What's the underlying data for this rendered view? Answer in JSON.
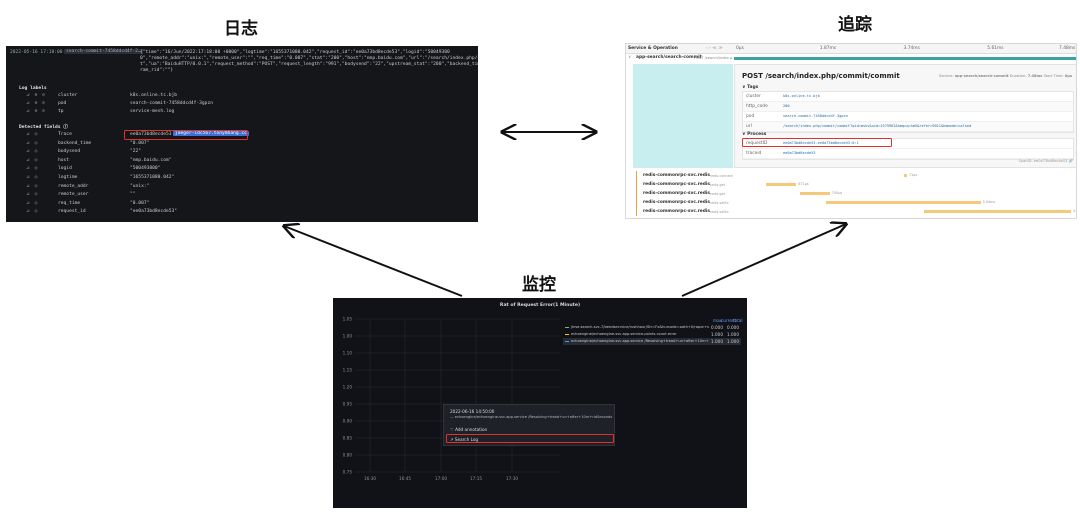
{
  "titles": {
    "log": "日志",
    "trace": "追踪",
    "monitor": "监控"
  },
  "log": {
    "timestamp": "2022-05-16 17:18:00",
    "pod_tag": "search-commit-7458ddcd4f-2…",
    "json_lines": [
      "{\"time\":\"16/Jun/2022:17:18:00 +0800\",\"logtime\":\"1655371080.042\",\"request_id\":\"ee0a73bd8ecde53\",\"logid\":\"50049380",
      "0\",\"remote_addr\":\"unix:\",\"remote_user\":\"\",\"req_time\":\"0.007\",\"stat\":\"200\",\"host\":\"nmp.baidu.com\",\"url\":\"/search/index.php/commit/commi",
      "t\",\"ua\":\"BaiduHTTP/0.0.1\",\"request_method\":\"POST\",\"request_length\":\"991\",\"bodysend\":\"22\",\"upstream_stat\":\"200\",\"backend_time\":\"0.007\",\"upstr",
      "ram_rid\":\"\"}"
    ],
    "labels_header": "Log labels",
    "labels": [
      {
        "key": "cluster",
        "value": "k8s.online.tc.bjb"
      },
      {
        "key": "pod",
        "value": "search-commit-7458ddcd4f-3gpzn"
      },
      {
        "key": "tp",
        "value": "service-mesh.log"
      }
    ],
    "fields_header": "Detected fields ⓘ",
    "fields": [
      {
        "key": "Trace",
        "value": "ee0a73bd8ecde53",
        "tag": "jaeger-idc567.tonymhang.cc"
      },
      {
        "key": "backend_time",
        "value": "\"0.007\""
      },
      {
        "key": "bodysend",
        "value": "\"22\""
      },
      {
        "key": "host",
        "value": "\"nmp.baidu.com\""
      },
      {
        "key": "logid",
        "value": "\"500493800\""
      },
      {
        "key": "logtime",
        "value": "\"1655371080.042\""
      },
      {
        "key": "remote_addr",
        "value": "\"unix:\""
      },
      {
        "key": "remote_user",
        "value": "\"\""
      },
      {
        "key": "req_time",
        "value": "\"0.007\""
      },
      {
        "key": "request_id",
        "value": "\"ee0a73bd8ecde53\""
      }
    ]
  },
  "trace": {
    "header": {
      "col1": "Service & Operation",
      "ticks": [
        "0μs",
        "1.87ms",
        "3.74ms",
        "5.61ms",
        "7.48ms"
      ]
    },
    "root_span": "app-search/search-commit",
    "root_op": "POST /search/index.p…",
    "detail_title": "POST /search/index.php/commit/commit",
    "detail_service_label": "Service:",
    "detail_service": "app-search/search-commit",
    "detail_duration_label": "Duration:",
    "detail_duration": "7.48ms",
    "detail_start_label": "Start Time:",
    "detail_start": "0μs",
    "tags_header": "Tags",
    "tags": [
      {
        "key": "cluster",
        "value": "k8s.online.tc.bjb"
      },
      {
        "key": "http_code",
        "value": "200"
      },
      {
        "key": "pod",
        "value": "search-commit-7458ddcd4f-3gpzn"
      },
      {
        "key": "url",
        "value": "/search/index.php/commit/commit?qid=mskv&uid=1575962&hmqcq=hm5&refer=9011&hmmode=calsed"
      }
    ],
    "process_header": "Process",
    "process": [
      {
        "key": "requestID",
        "value": "ee0a73bd8ecde53-ee0a73bd8ecde53:0:1"
      },
      {
        "key": "traceid",
        "value": "ee0a73bd8ecde53"
      }
    ],
    "spanid_label": "SpanID:",
    "spanid": "ee0a73bd8ecde53",
    "child_spans": [
      {
        "service": "redis-commonrpc-svc.redis",
        "op": "redis.connect",
        "label": "71μs",
        "start": 0.5,
        "dur": 0.01
      },
      {
        "service": "redis-commonrpc-svc.redis",
        "op": "redis.get",
        "label": "671μs",
        "start": 0.09,
        "dur": 0.09
      },
      {
        "service": "redis-commonrpc-svc.redis",
        "op": "redis.get",
        "label": "700μs",
        "start": 0.19,
        "dur": 0.09
      },
      {
        "service": "redis-commonrpc-svc.redis",
        "op": "redis.setEx",
        "label": "3.44ms",
        "start": 0.27,
        "dur": 0.46
      },
      {
        "service": "redis-commonrpc-svc.redis",
        "op": "redis.setEx",
        "label": "3.29ms",
        "start": 0.56,
        "dur": 0.44
      }
    ]
  },
  "monitor": {
    "title": "Rat of Request Error(1 Minute)",
    "legend_cols": [
      "max",
      "current",
      "total"
    ],
    "legend": [
      {
        "name": "jinse.search-svc-7/bendsecrvice/rushhour/Str=Fx&hurcode=oath+0/rapor+sucessd",
        "max": "0.000",
        "current": "0.000",
        "color": "#73bf69"
      },
      {
        "name": "echoengine/echoengine-svc.app.service.points.count.error",
        "max": "1.000",
        "current": "1.000",
        "color": "#f2cc0c"
      },
      {
        "name": "echoengine/echoengine-svc.app.service /Resolving+tread+un+after+10m+ridSeconds",
        "max": "1.000",
        "current": "1.000",
        "color": "#5794f2"
      }
    ],
    "tooltip_time": "2022-06-16 14:50:00",
    "tooltip_series": "echoengine/echoengine-svc.app.service /Resolving+tread+un+after+10m+ridSeconds",
    "menu_add": "Add annotation",
    "menu_search": "Search Log"
  },
  "chart_data": {
    "type": "line",
    "title": "Rat of Request Error(1 Minute)",
    "x": [
      "16:30",
      "16:45",
      "17:00",
      "17:15",
      "17:30"
    ],
    "ylim": [
      0.75,
      1.05
    ],
    "yticks": [
      "1.05",
      "1.00",
      "1.10",
      "1.15",
      "1.20",
      "0.95",
      "0.90",
      "0.85",
      "0.80",
      "0.75"
    ],
    "series": []
  }
}
